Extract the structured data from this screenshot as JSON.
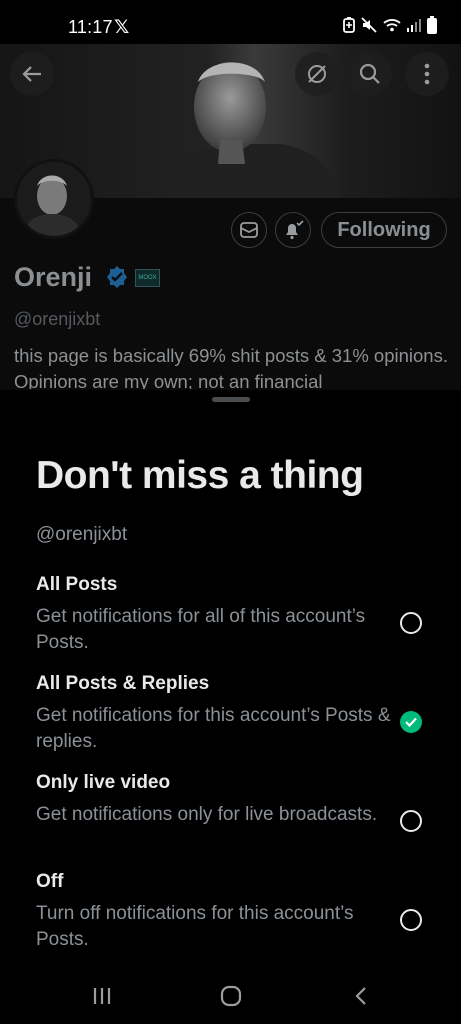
{
  "status_bar": {
    "time": "11:17",
    "app_glyph": "𝕏",
    "icons": [
      "battery-saver-icon",
      "mute-icon",
      "wifi-icon",
      "signal-icon",
      "battery-icon"
    ]
  },
  "profile": {
    "name": "Orenji",
    "handle": "@orenjixbt",
    "bio": "this page is basically 69% shit posts & 31% opinions. Opinions are my own; not an financial",
    "following_label": "Following",
    "affiliate_badge_text": "MOOX",
    "top_icons": [
      "back-arrow-icon",
      "grok-icon",
      "search-icon",
      "more-vertical-icon"
    ],
    "action_icons": [
      "mail-icon",
      "bell-icon"
    ]
  },
  "sheet": {
    "title": "Don't miss a thing",
    "handle": "@orenjixbt",
    "options": [
      {
        "title": "All Posts",
        "desc": "Get notifications for all of this account’s Posts.",
        "selected": false
      },
      {
        "title": "All Posts & Replies",
        "desc": "Get notifications for this account’s Posts & replies.",
        "selected": true
      },
      {
        "title": "Only live video",
        "desc": "Get notifications only for live broadcasts.",
        "selected": false
      },
      {
        "title": "Off",
        "desc": "Turn off notifications for this account’s Posts.",
        "selected": false
      }
    ]
  },
  "nav": {
    "icons": [
      "recent-apps-icon",
      "home-icon",
      "back-icon"
    ]
  },
  "colors": {
    "accent_green": "#00ba7c",
    "verified_blue": "#1d9bf0",
    "text_primary": "#e7e9ea",
    "text_secondary": "#8b9196"
  }
}
